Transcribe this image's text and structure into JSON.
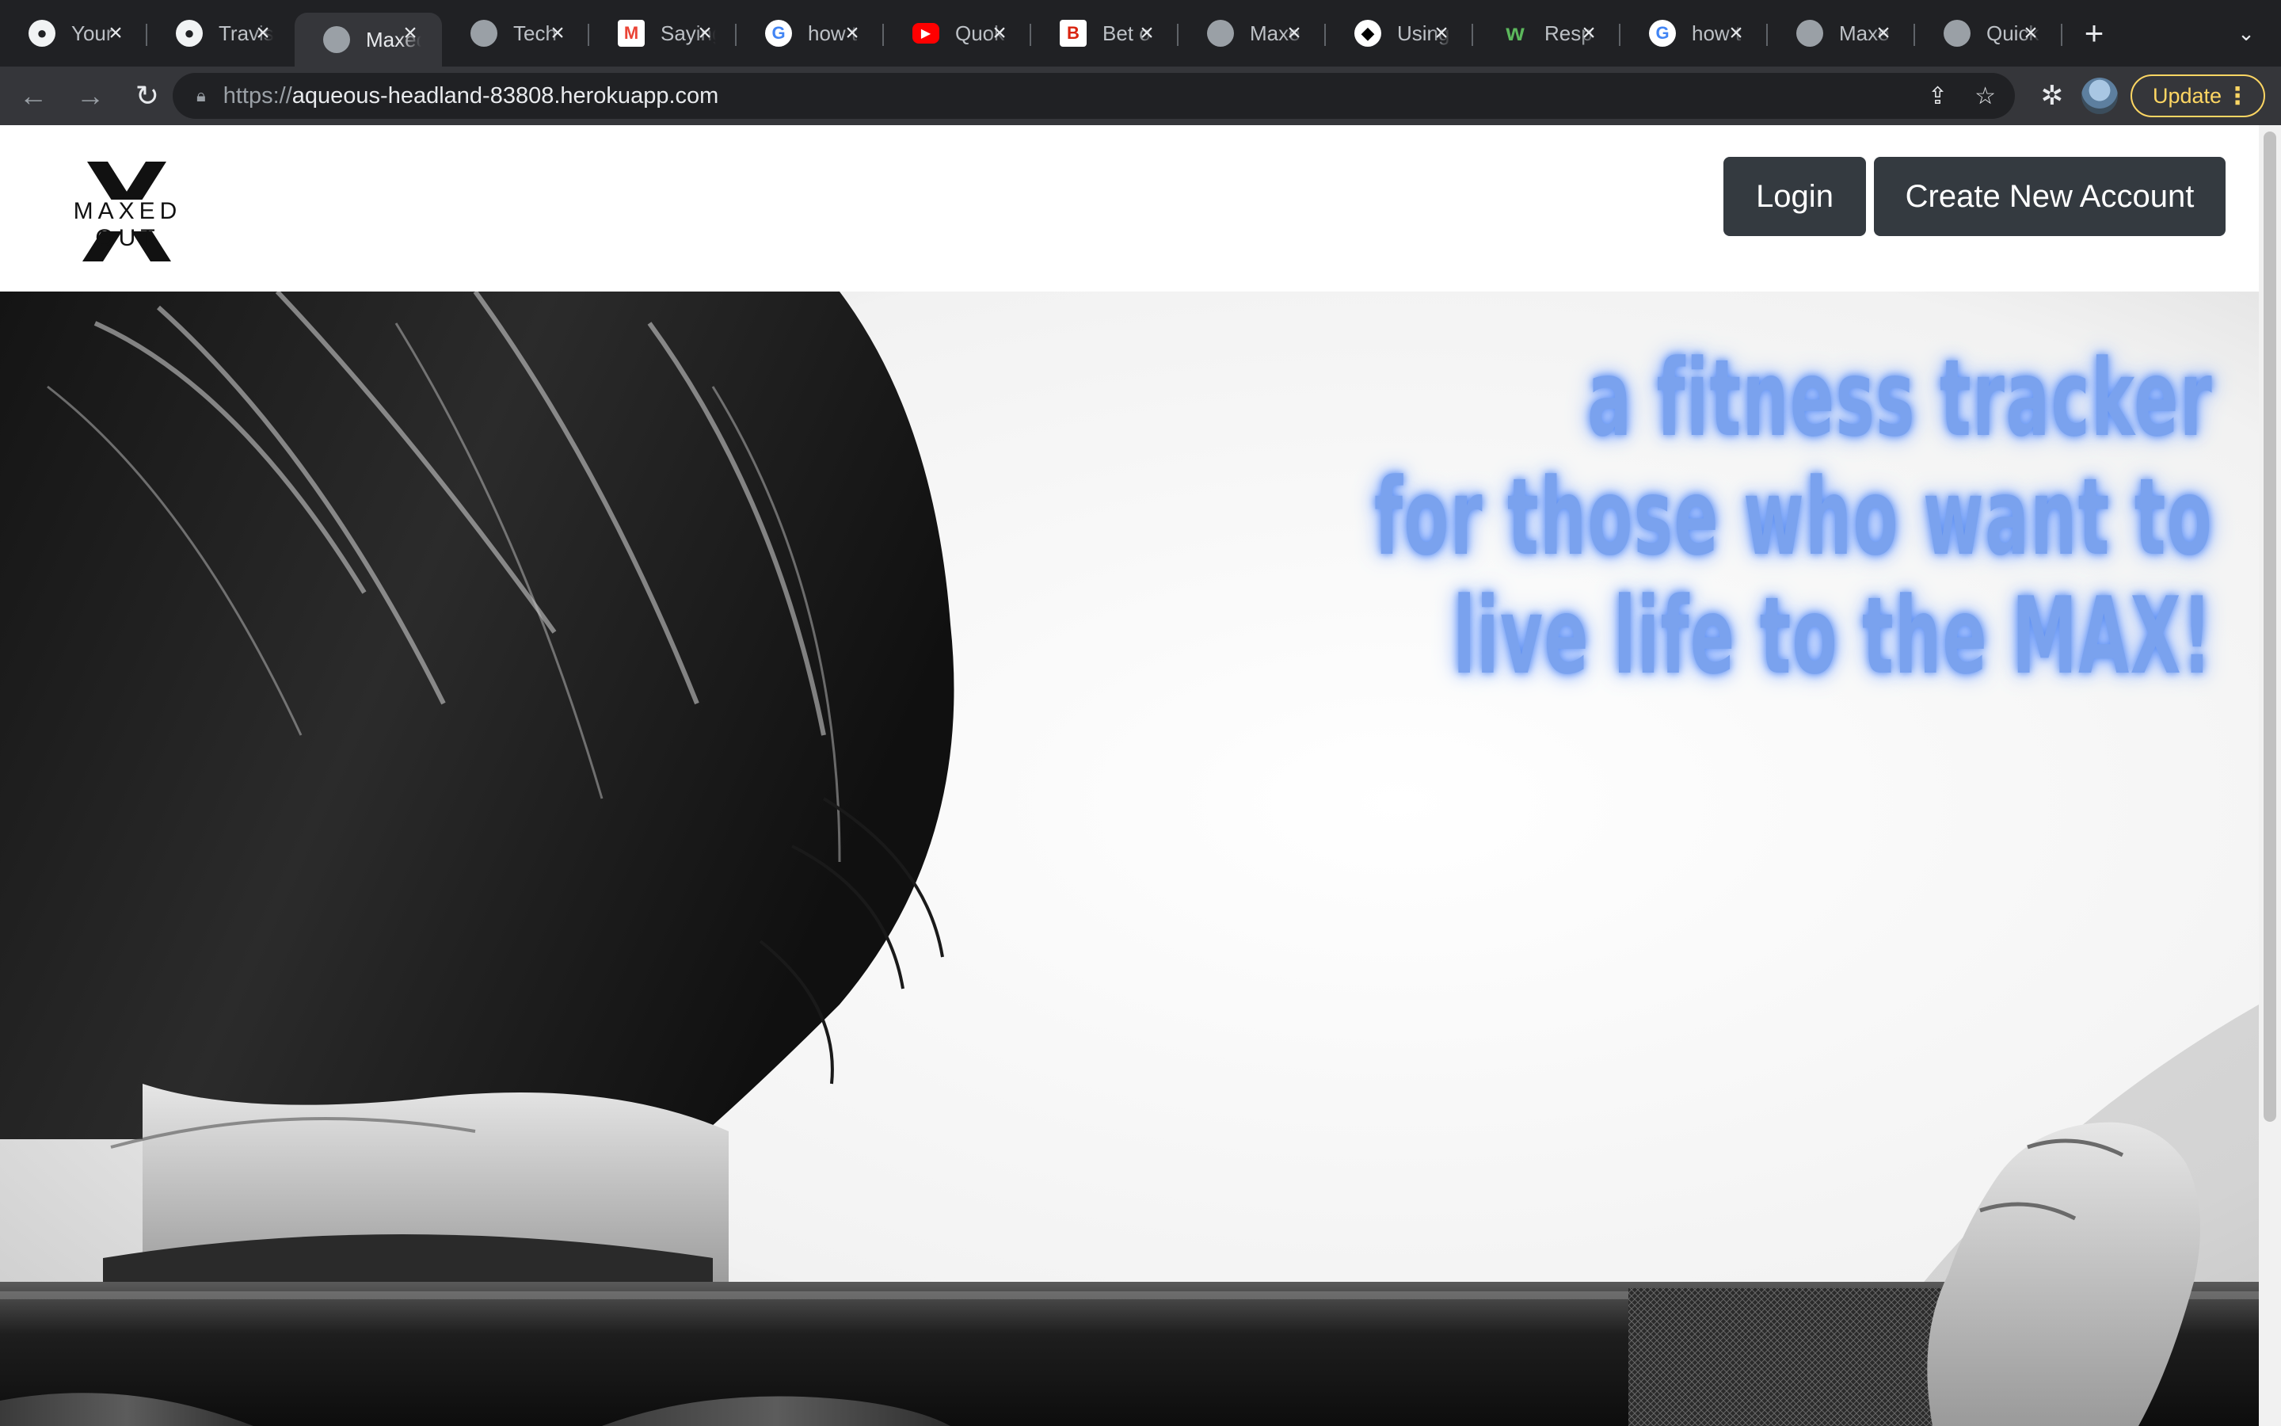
{
  "browser": {
    "tabs": [
      {
        "title": "Your",
        "favicon": "github-icon",
        "active": false
      },
      {
        "title": "Travis",
        "favicon": "github-icon",
        "active": false
      },
      {
        "title": "Maxed",
        "favicon": "globe-icon",
        "active": true
      },
      {
        "title": "Tech",
        "favicon": "globe-icon",
        "active": false
      },
      {
        "title": "Saying",
        "favicon": "gmail-icon",
        "active": false
      },
      {
        "title": "how t",
        "favicon": "google-icon",
        "active": false
      },
      {
        "title": "Quok",
        "favicon": "youtube-icon",
        "active": false
      },
      {
        "title": "Bet o",
        "favicon": "bootswatch-icon",
        "active": false
      },
      {
        "title": "Maxe",
        "favicon": "globe-icon",
        "active": false
      },
      {
        "title": "Using",
        "favicon": "shield-icon",
        "active": false
      },
      {
        "title": "Resp",
        "favicon": "w3-icon",
        "active": false
      },
      {
        "title": "how t",
        "favicon": "google-icon",
        "active": false
      },
      {
        "title": "Maxe",
        "favicon": "globe-icon",
        "active": false
      },
      {
        "title": "Quick",
        "favicon": "globe-icon",
        "active": false
      }
    ],
    "url_scheme": "https://",
    "url_host": "aqueous-headland-83808.herokuapp.com",
    "update_label": "Update"
  },
  "site": {
    "logo_text": "MAXED OUT",
    "login_label": "Login",
    "create_account_label": "Create New Account",
    "tagline": {
      "line1": "a fitness tracker",
      "line2": "for those who want to",
      "line3": "live life to the MAX!"
    },
    "colors": {
      "button_bg": "#343a40",
      "tagline_color": "#7aa2ee",
      "tagline_glow": "#5d8ff0"
    }
  }
}
